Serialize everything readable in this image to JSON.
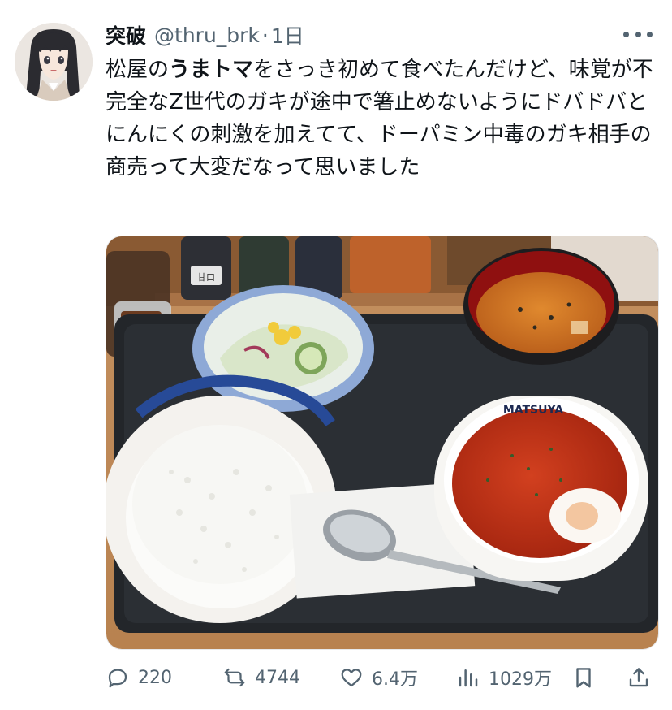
{
  "post": {
    "display_name": "突破",
    "handle": "@thru_brk",
    "separator": "·",
    "time": "1日",
    "text_before": "松屋の",
    "text_bold": "うまトマ",
    "text_after": "をさっき初めて食べたんだけど、味覚が不完全なZ世代のガキが途中で箸止めないようにドバドバとにんにくの刺激を加えてて、ドーパミン中毒のガキ相手の商売って大変だなって思いました",
    "media_tray_label": "MATSUYA",
    "media_shaker_label": "甘口"
  },
  "actions": {
    "replies": "220",
    "reposts": "4744",
    "likes": "6.4万",
    "views": "1029万"
  },
  "icons": {
    "reply": "speech-bubble-icon",
    "repost": "repost-arrows-icon",
    "like": "heart-icon",
    "views": "bar-chart-icon",
    "bookmark": "bookmark-icon",
    "share": "share-upload-icon",
    "more": "more-dots-icon"
  },
  "colors": {
    "text": "#0f1419",
    "secondary": "#536471"
  }
}
